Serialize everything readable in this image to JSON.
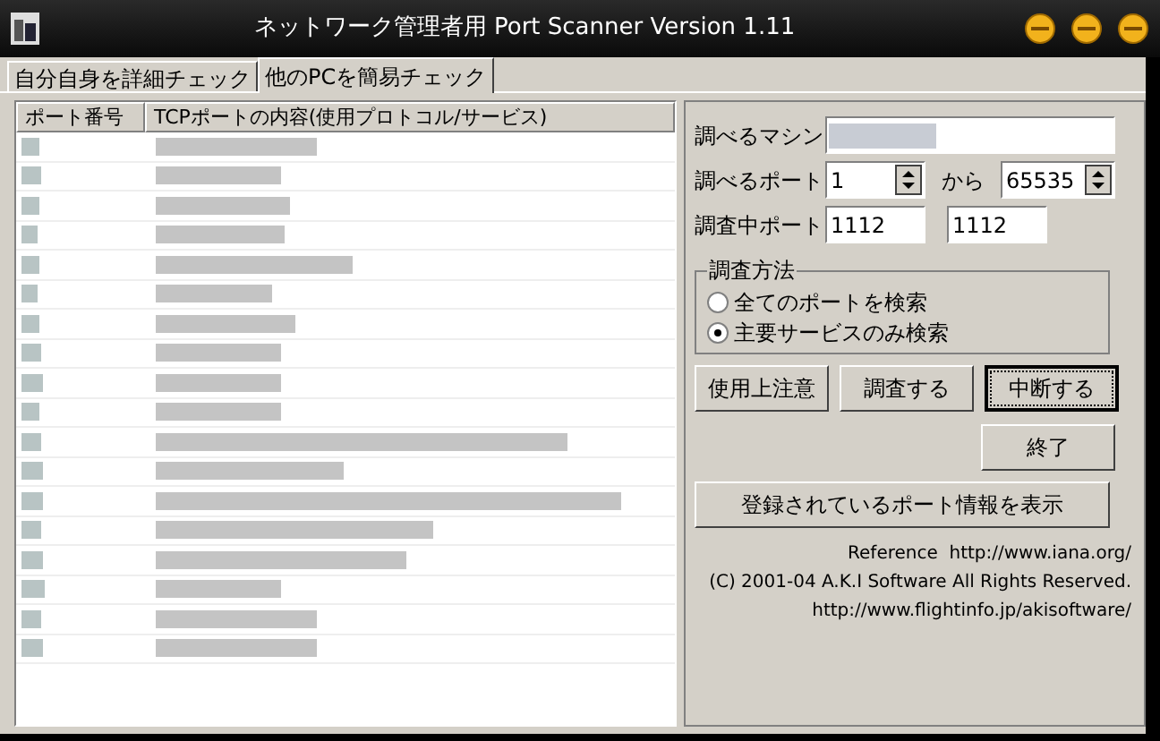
{
  "window": {
    "title": "ネットワーク管理者用 Port Scanner Version 1.11"
  },
  "tabs": [
    {
      "label": "自分自身を詳細チェック",
      "selected": false
    },
    {
      "label": "他のPCを簡易チェック",
      "selected": true
    }
  ],
  "table": {
    "columns": [
      "ポート番号",
      "TCPポートの内容(使用プロトコル/サービス)"
    ]
  },
  "machine": {
    "label": "調べるマシン"
  },
  "port_range": {
    "label": "調べるポート",
    "from": "1",
    "separator": "から",
    "to": "65535"
  },
  "current_port": {
    "label": "調査中ポート",
    "value_1": "1112",
    "value_2": "1112"
  },
  "method": {
    "title": "調査方法",
    "options": [
      {
        "label": "全てのポートを検索",
        "selected": false
      },
      {
        "label": "主要サービスのみ検索",
        "selected": true
      }
    ]
  },
  "buttons": [
    {
      "label": "使用上注意",
      "focused": false
    },
    {
      "label": "調査する",
      "focused": false
    },
    {
      "label": "中断する",
      "focused": true
    }
  ],
  "exit_button": "終了",
  "registered_button": "登録されているポート情報を表示",
  "footer": [
    "Reference  http://www.iana.org/",
    "(C) 2001-04 A.K.I Software All Rights Reserved.",
    "http://www.flightinfo.jp/akisoftware/"
  ]
}
